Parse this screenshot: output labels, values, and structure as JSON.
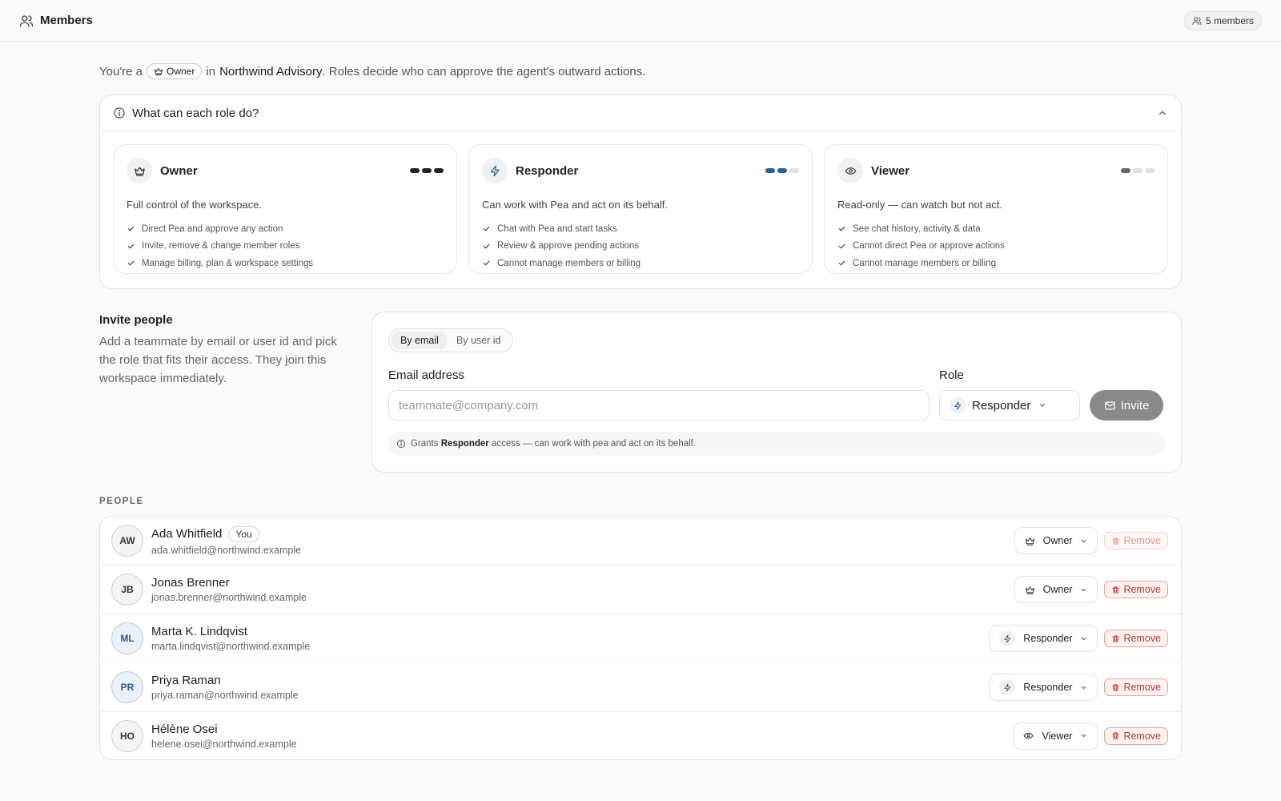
{
  "topbar": {
    "title": "Members",
    "member_count": "5 members"
  },
  "intro": {
    "prefix": "You're a",
    "role": "Owner",
    "middle": "in",
    "workspace": "Northwind Advisory",
    "suffix": ". Roles decide who can approve the agent's outward actions."
  },
  "roles_panel": {
    "title": "What can each role do?",
    "roles": [
      {
        "name": "Owner",
        "icon": "crown-icon",
        "level": 3,
        "dot_color": "#222222",
        "description": "Full control of the workspace.",
        "permissions": [
          "Direct Pea and approve any action",
          "Invite, remove & change member roles",
          "Manage billing, plan & workspace settings"
        ]
      },
      {
        "name": "Responder",
        "icon": "bolt-icon",
        "level": 2,
        "dot_color": "#2c5f8e",
        "description": "Can work with Pea and act on its behalf.",
        "permissions": [
          "Chat with Pea and start tasks",
          "Review & approve pending actions",
          "Cannot manage members or billing"
        ]
      },
      {
        "name": "Viewer",
        "icon": "eye-icon",
        "level": 1,
        "dot_color": "#666666",
        "description": "Read-only — can watch but not act.",
        "permissions": [
          "See chat history, activity & data",
          "Cannot direct Pea or approve actions",
          "Cannot manage members or billing"
        ]
      }
    ]
  },
  "invite": {
    "title": "Invite people",
    "description": "Add a teammate by email or user id and pick the role that fits their access. They join this workspace immediately.",
    "tabs": [
      "By email",
      "By user id"
    ],
    "email_label": "Email address",
    "email_value": "",
    "email_placeholder": "teammate@company.com",
    "role_label": "Role",
    "role_value": "Responder",
    "button": "Invite",
    "grants_prefix": "Grants",
    "grants_role": "Responder",
    "grants_suffix": "access — can work with pea and act on its behalf."
  },
  "people": {
    "label": "PEOPLE",
    "remove_label": "Remove",
    "you_label": "You",
    "members": [
      {
        "initials": "AW",
        "name": "Ada Whitfield",
        "email": "ada.whitfield@northwind.example",
        "role": "Owner",
        "is_you": true,
        "remove_enabled": false
      },
      {
        "initials": "JB",
        "name": "Jonas Brenner",
        "email": "jonas.brenner@northwind.example",
        "role": "Owner",
        "is_you": false,
        "remove_enabled": true
      },
      {
        "initials": "ML",
        "name": "Marta K. Lindqvist",
        "email": "marta.lindqvist@northwind.example",
        "role": "Responder",
        "is_you": false,
        "remove_enabled": true
      },
      {
        "initials": "PR",
        "name": "Priya Raman",
        "email": "priya.raman@northwind.example",
        "role": "Responder",
        "is_you": false,
        "remove_enabled": true
      },
      {
        "initials": "HO",
        "name": "Hélène Osei",
        "email": "helene.osei@northwind.example",
        "role": "Viewer",
        "is_you": false,
        "remove_enabled": true
      }
    ]
  }
}
